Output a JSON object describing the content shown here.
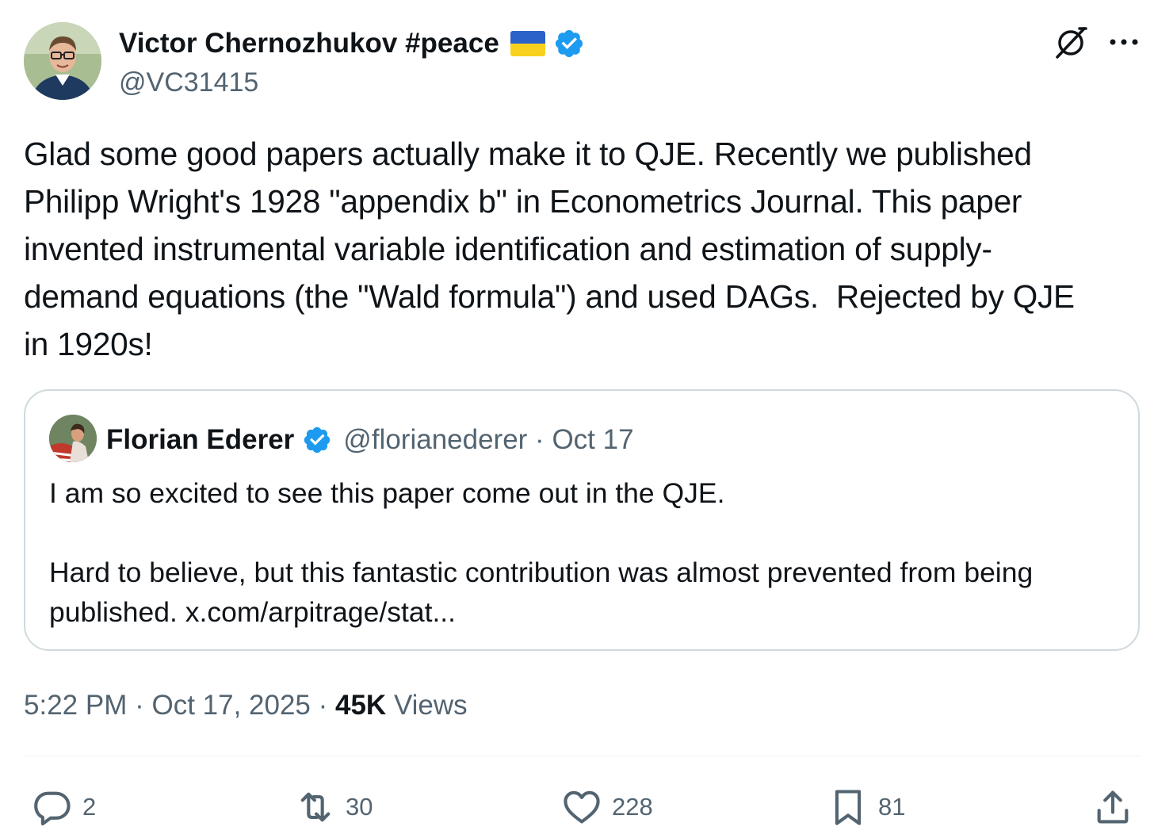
{
  "author": {
    "display_name": "Victor Chernozhukov #peace",
    "handle": "@VC31415",
    "flag_colors": {
      "top": "#2a62c9",
      "bottom": "#f8d11f"
    },
    "verified_color": "#1d9bf0",
    "avatar_icon": "person-avatar"
  },
  "header_icons": {
    "grok": "grok-icon",
    "more": "more-icon"
  },
  "tweet": {
    "text": "Glad some good papers actually make it to QJE. Recently we published\nPhilipp Wright's 1928 \"appendix b\" in Econometrics Journal. This paper\ninvented instrumental variable identification and estimation of supply-\ndemand equations (the \"Wald formula\") and used DAGs.  Rejected by QJE\nin 1920s!"
  },
  "quote": {
    "name": "Florian Ederer",
    "handle": "@florianederer",
    "separator": " · ",
    "date": "Oct 17",
    "text": "I am so excited to see this paper come out in the QJE.\n\nHard to believe, but this fantastic contribution was almost prevented from being\npublished. x.com/arpitrage/stat..."
  },
  "meta": {
    "time": "5:22 PM",
    "sep": " · ",
    "date": "Oct 17, 2025",
    "sep2": " · ",
    "views_count": "45K",
    "views_label": " Views"
  },
  "actions": {
    "reply": {
      "icon": "reply-icon",
      "count": "2"
    },
    "repost": {
      "icon": "repost-icon",
      "count": "30"
    },
    "like": {
      "icon": "heart-icon",
      "count": "228"
    },
    "bookmark": {
      "icon": "bookmark-icon",
      "count": "81"
    },
    "share": {
      "icon": "share-icon"
    }
  },
  "colors": {
    "text": "#0f1419",
    "secondary": "#536471",
    "border": "#cfd9de",
    "accent": "#1d9bf0"
  }
}
